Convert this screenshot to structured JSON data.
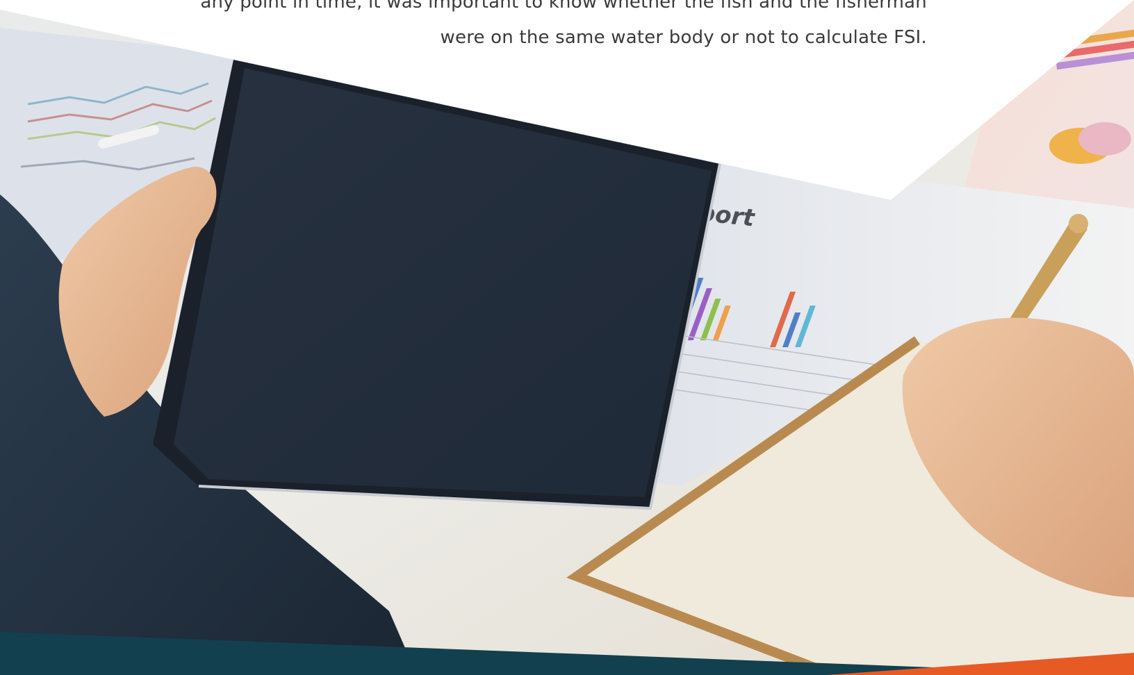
{
  "article": {
    "line_1": "any point in time, it was important to know whether the fish and the fisherman",
    "line_2": "were on the same water body or not to calculate FSI."
  },
  "photo": {
    "report_heading": "port",
    "description_icon": "photo-tablet-report"
  },
  "colors": {
    "text": "#3a3a3a",
    "teal_band": "#12404f",
    "orange_band": "#e85a24",
    "tablet_screen": "#24303f"
  }
}
